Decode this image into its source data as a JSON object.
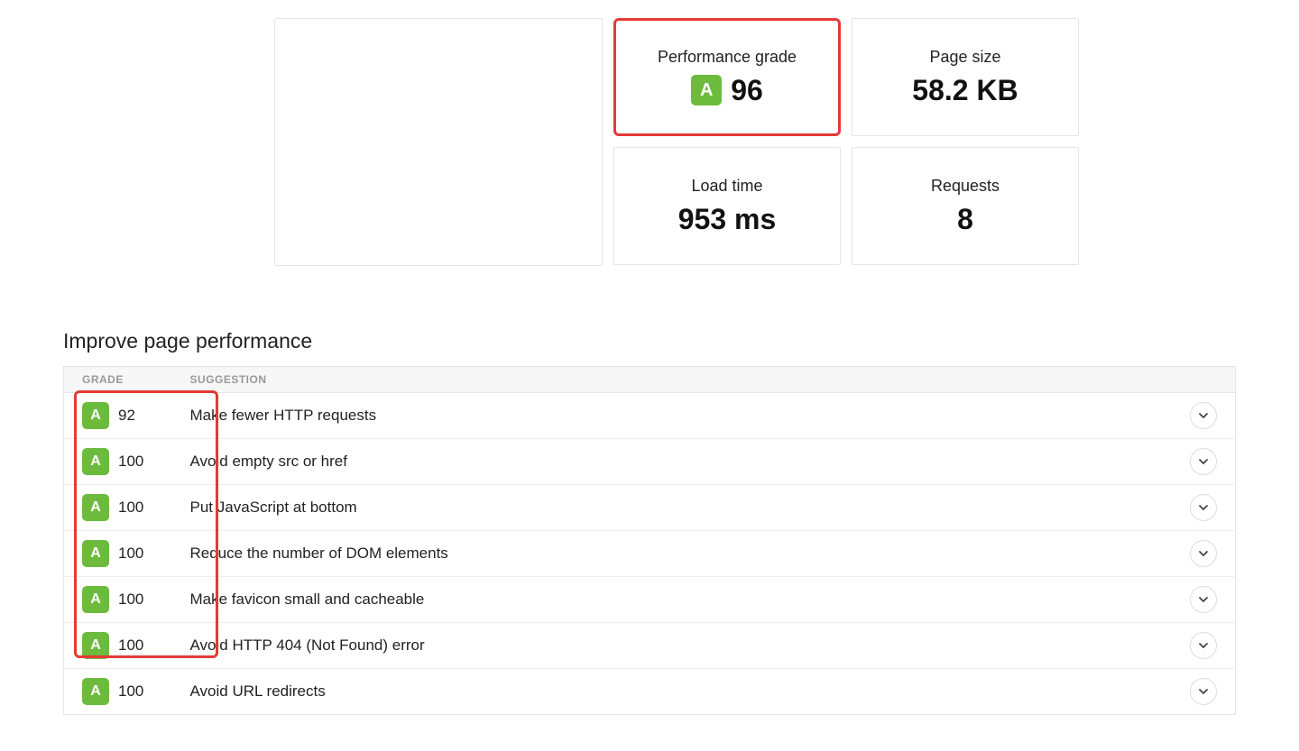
{
  "stats": {
    "performance": {
      "label": "Performance grade",
      "grade": "A",
      "value": "96"
    },
    "pagesize": {
      "label": "Page size",
      "value": "58.2 KB"
    },
    "loadtime": {
      "label": "Load time",
      "value": "953 ms"
    },
    "requests": {
      "label": "Requests",
      "value": "8"
    }
  },
  "sectionTitle": "Improve page performance",
  "headers": {
    "grade": "GRADE",
    "suggestion": "SUGGESTION"
  },
  "rows": [
    {
      "grade": "A",
      "score": "92",
      "suggestion": "Make fewer HTTP requests"
    },
    {
      "grade": "A",
      "score": "100",
      "suggestion": "Avoid empty src or href"
    },
    {
      "grade": "A",
      "score": "100",
      "suggestion": "Put JavaScript at bottom"
    },
    {
      "grade": "A",
      "score": "100",
      "suggestion": "Reduce the number of DOM elements"
    },
    {
      "grade": "A",
      "score": "100",
      "suggestion": "Make favicon small and cacheable"
    },
    {
      "grade": "A",
      "score": "100",
      "suggestion": "Avoid HTTP 404 (Not Found) error"
    },
    {
      "grade": "A",
      "score": "100",
      "suggestion": "Avoid URL redirects"
    }
  ]
}
